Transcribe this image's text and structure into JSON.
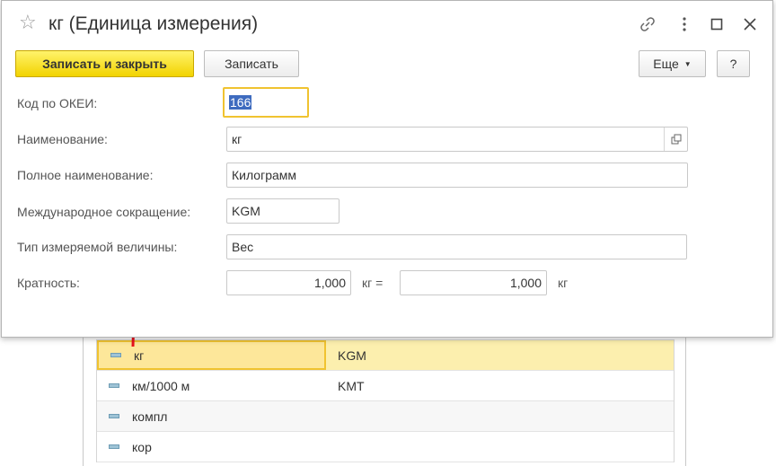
{
  "window": {
    "title": "кг (Единица измерения)",
    "icons": [
      "star-icon",
      "link-icon",
      "more-icon",
      "maximize-icon",
      "close-icon"
    ]
  },
  "toolbar": {
    "save_close_label": "Записать и закрыть",
    "save_label": "Записать",
    "more_label": "Еще",
    "help_label": "?"
  },
  "form": {
    "okei_label": "Код по ОКЕИ:",
    "okei_value": "166",
    "name_label": "Наименование:",
    "name_value": "кг",
    "fullname_label": "Полное наименование:",
    "fullname_value": "Килограмм",
    "intl_label": "Международное сокращение:",
    "intl_value": "KGM",
    "type_label": "Тип измеряемой величины:",
    "type_value": "Вес",
    "ratio_label": "Кратность:",
    "ratio_value1": "1,000",
    "ratio_unit1": "кг =",
    "ratio_value2": "1,000",
    "ratio_unit2": "кг"
  },
  "list": {
    "rows": [
      {
        "name": "кг",
        "code": "KGM"
      },
      {
        "name": "км/1000 м",
        "code": "KMT"
      },
      {
        "name": "компл",
        "code": ""
      },
      {
        "name": "кор",
        "code": ""
      }
    ]
  },
  "colors": {
    "accent_yellow": "#f2d300",
    "focus_border": "#f0c330",
    "selection_blue": "#3e6bbf",
    "arrow_red": "#e8121c"
  }
}
